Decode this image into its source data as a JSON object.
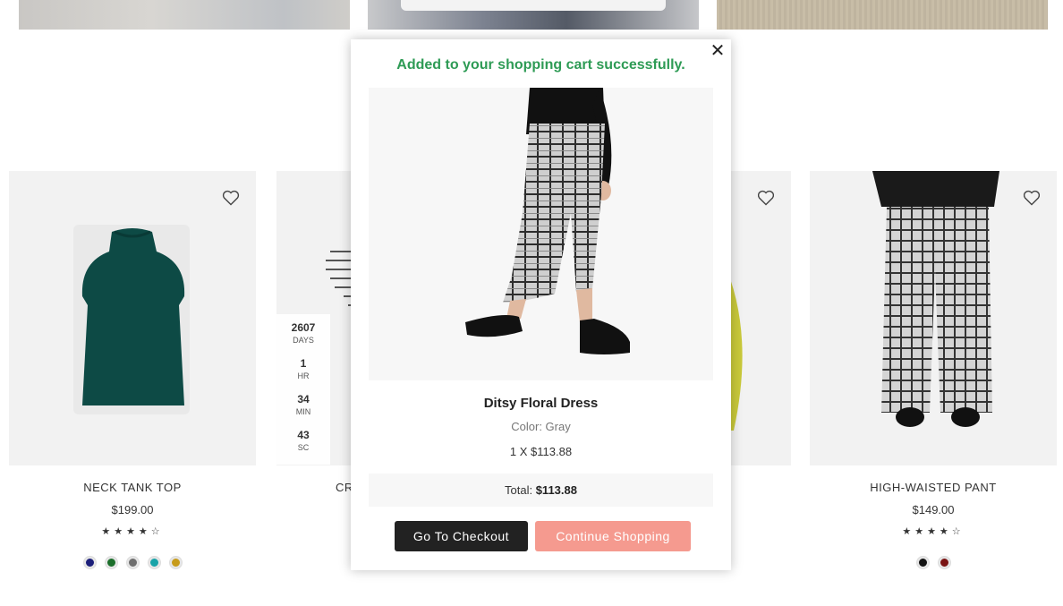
{
  "products": [
    {
      "name": "NECK TANK TOP",
      "price": "$199.00",
      "rating": "★★★★☆",
      "swatches": [
        "#1c1f7a",
        "#1b6e2a",
        "#6e6e6e",
        "#18a3a8",
        "#c79b1a"
      ]
    },
    {
      "name": "CR",
      "price": "",
      "rating": "",
      "swatches": [],
      "countdown": [
        {
          "value": "2607",
          "label": "DAYS"
        },
        {
          "value": "1",
          "label": "HR"
        },
        {
          "value": "34",
          "label": "MIN"
        },
        {
          "value": "43",
          "label": "SC"
        }
      ]
    },
    {
      "name": "",
      "price": "",
      "rating": "",
      "swatches": []
    },
    {
      "name": "HIGH-WAISTED PANT",
      "price": "$149.00",
      "rating": "★★★★☆",
      "swatches": [
        "#111111",
        "#7a1414"
      ]
    }
  ],
  "modal": {
    "close": "✕",
    "message": "Added to your shopping cart successfully.",
    "product_name": "Ditsy Floral Dress",
    "color_line": "Color: Gray",
    "qty_line": "1 X $113.88",
    "total_label": "Total:",
    "total_value": "$113.88",
    "checkout_label": "Go To Checkout",
    "continue_label": "Continue Shopping"
  },
  "icons": {
    "wishlist": "heart-icon",
    "close": "close-icon"
  },
  "colors": {
    "success": "#2e9b55",
    "checkout_btn": "#222222",
    "continue_btn": "#f59a8f"
  }
}
